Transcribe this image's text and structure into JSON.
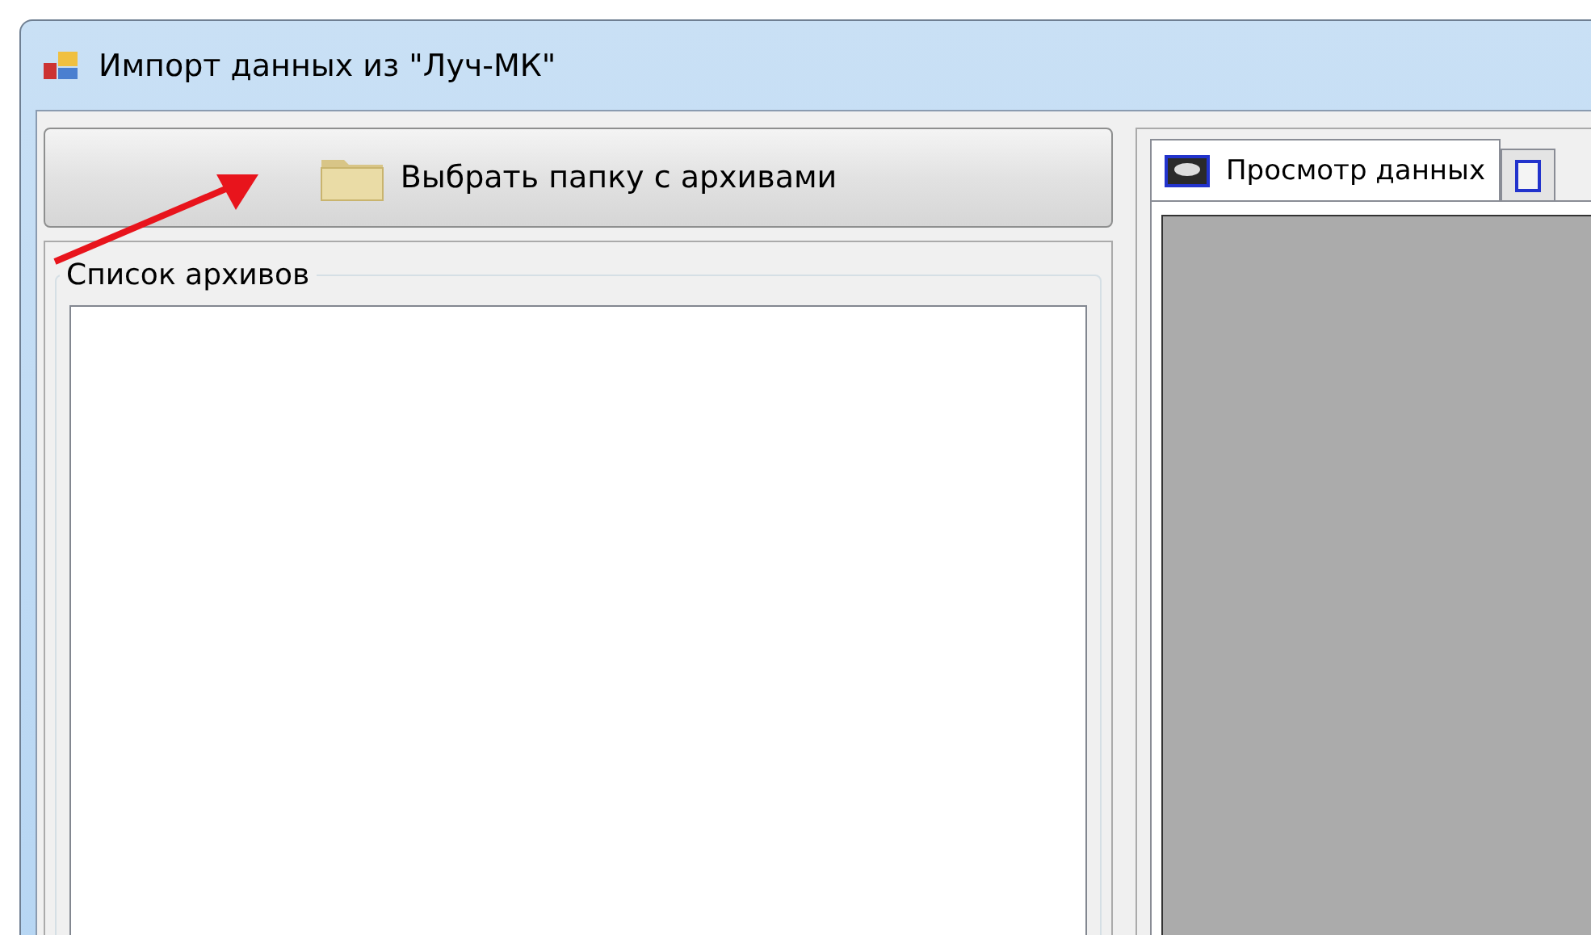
{
  "window": {
    "title": "Импорт данных из \"Луч-МК\""
  },
  "choose_folder_button": {
    "label": "Выбрать папку с архивами"
  },
  "archive_group": {
    "title": "Список архивов"
  },
  "tabs": [
    {
      "label": "Просмотр данных",
      "selected": true
    },
    {
      "selected": false
    }
  ]
}
